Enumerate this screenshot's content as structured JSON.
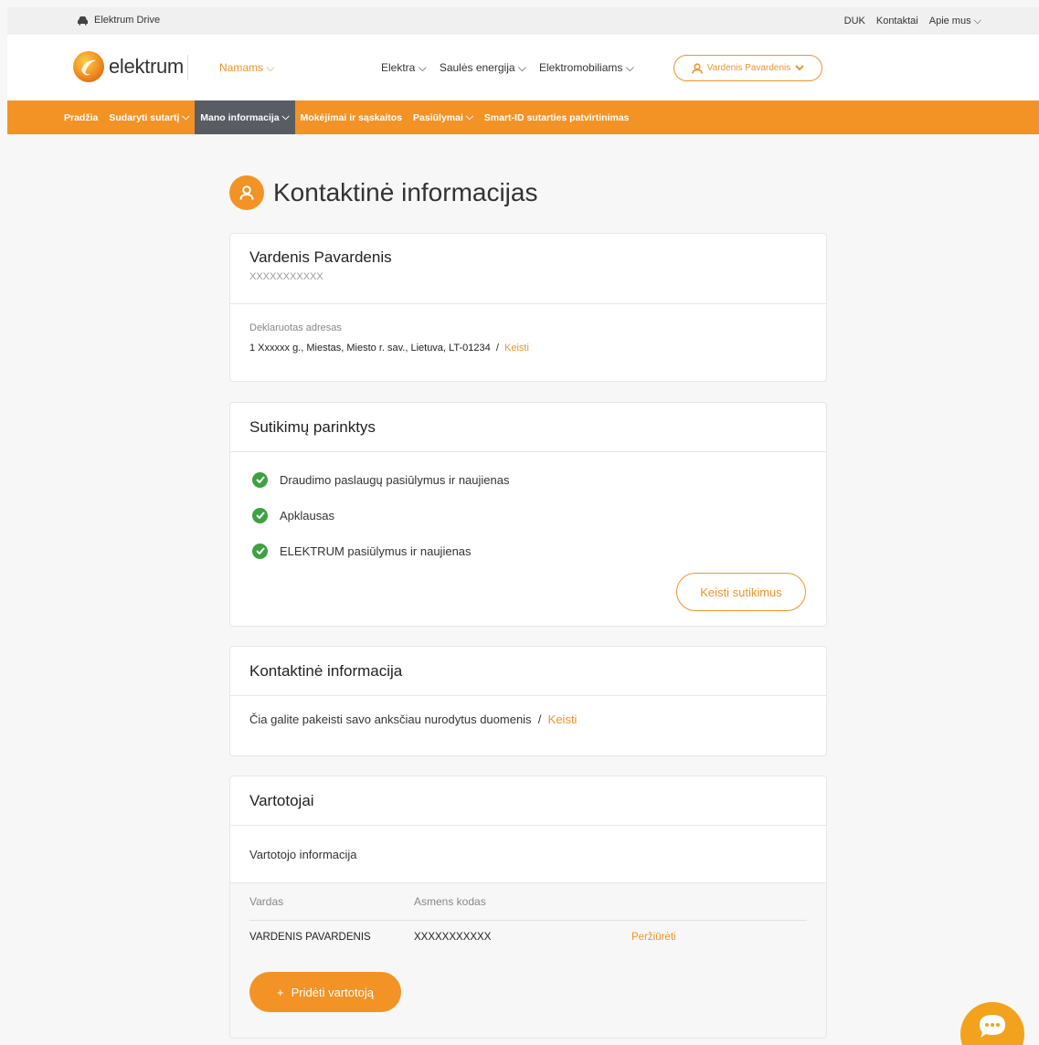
{
  "topbar": {
    "drive_label": "Elektrum Drive",
    "links": [
      "DUK",
      "Kontaktai",
      "Apie mus"
    ]
  },
  "nav": {
    "logo_text": "elektrum",
    "segment": "Namams",
    "items": [
      "Elektra",
      "Saulės energija",
      "Elektromobiliams"
    ],
    "user_name": "Vardenis Pavardenis"
  },
  "subnav": {
    "items": [
      "Pradžia",
      "Sudaryti sutartį",
      "Mano informacija",
      "Mokėjimai ir sąskaitos",
      "Pasiūlymai",
      "Smart-ID sutarties patvirtinimas"
    ]
  },
  "page": {
    "title": "Kontaktinė informacijas"
  },
  "profile": {
    "name": "Vardenis Pavardenis",
    "id": "XXXXXXXXXXX",
    "address_label": "Deklaruotas adresas",
    "address": "1 Xxxxxx g., Miestas, Miesto r. sav., Lietuva, LT-01234",
    "separator": "/",
    "change_label": "Keisti"
  },
  "consents": {
    "title": "Sutikimų parinktys",
    "items": [
      "Draudimo paslaugų pasiūlymus ir naujienas",
      "Apklausas",
      "ELEKTRUM pasiūlymus ir naujienas"
    ],
    "button": "Keisti sutikimus"
  },
  "contact": {
    "title": "Kontaktinė informacija",
    "text": "Čia galite pakeisti savo anksčiau nurodytus duomenis",
    "separator": "/",
    "link": "Keisti"
  },
  "users": {
    "title": "Vartotojai",
    "subtitle": "Vartotojo informacija",
    "columns": [
      "Vardas",
      "Asmens kodas"
    ],
    "rows": [
      {
        "name": "VARDENIS PAVARDENIS",
        "code": "XXXXXXXXXXX",
        "action": "Peržiūrėti"
      }
    ],
    "add_button": "Pridėti vartotoją"
  },
  "colors": {
    "accent": "#f39325",
    "active_tab": "#585c63",
    "check": "#3fa142"
  }
}
